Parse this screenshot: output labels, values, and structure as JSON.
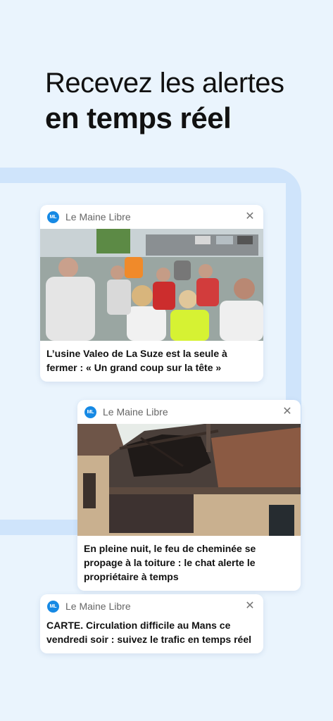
{
  "headline": {
    "line1": "Recevez les alertes",
    "line2": "en temps réel"
  },
  "notifications": [
    {
      "logo": "ML",
      "source": "Le Maine Libre",
      "close": "✕",
      "title": "L’usine Valeo de La Suze est la seule à fermer : « Un grand coup sur la tête »",
      "image": "crowd-of-workers-photo"
    },
    {
      "logo": "ML",
      "source": "Le Maine Libre",
      "close": "✕",
      "title": "En pleine nuit, le feu de cheminée se propage à la toiture : le chat alerte le propriétaire à temps",
      "image": "burnt-roof-photo"
    },
    {
      "logo": "ML",
      "source": "Le Maine Libre",
      "close": "✕",
      "title": "CARTE. Circulation difficile au Mans ce vendredi soir : suivez le trafic en temps réel"
    }
  ],
  "colors": {
    "background": "#eaf4fd",
    "track": "#cfe4fb",
    "brand": "#1689e4"
  }
}
